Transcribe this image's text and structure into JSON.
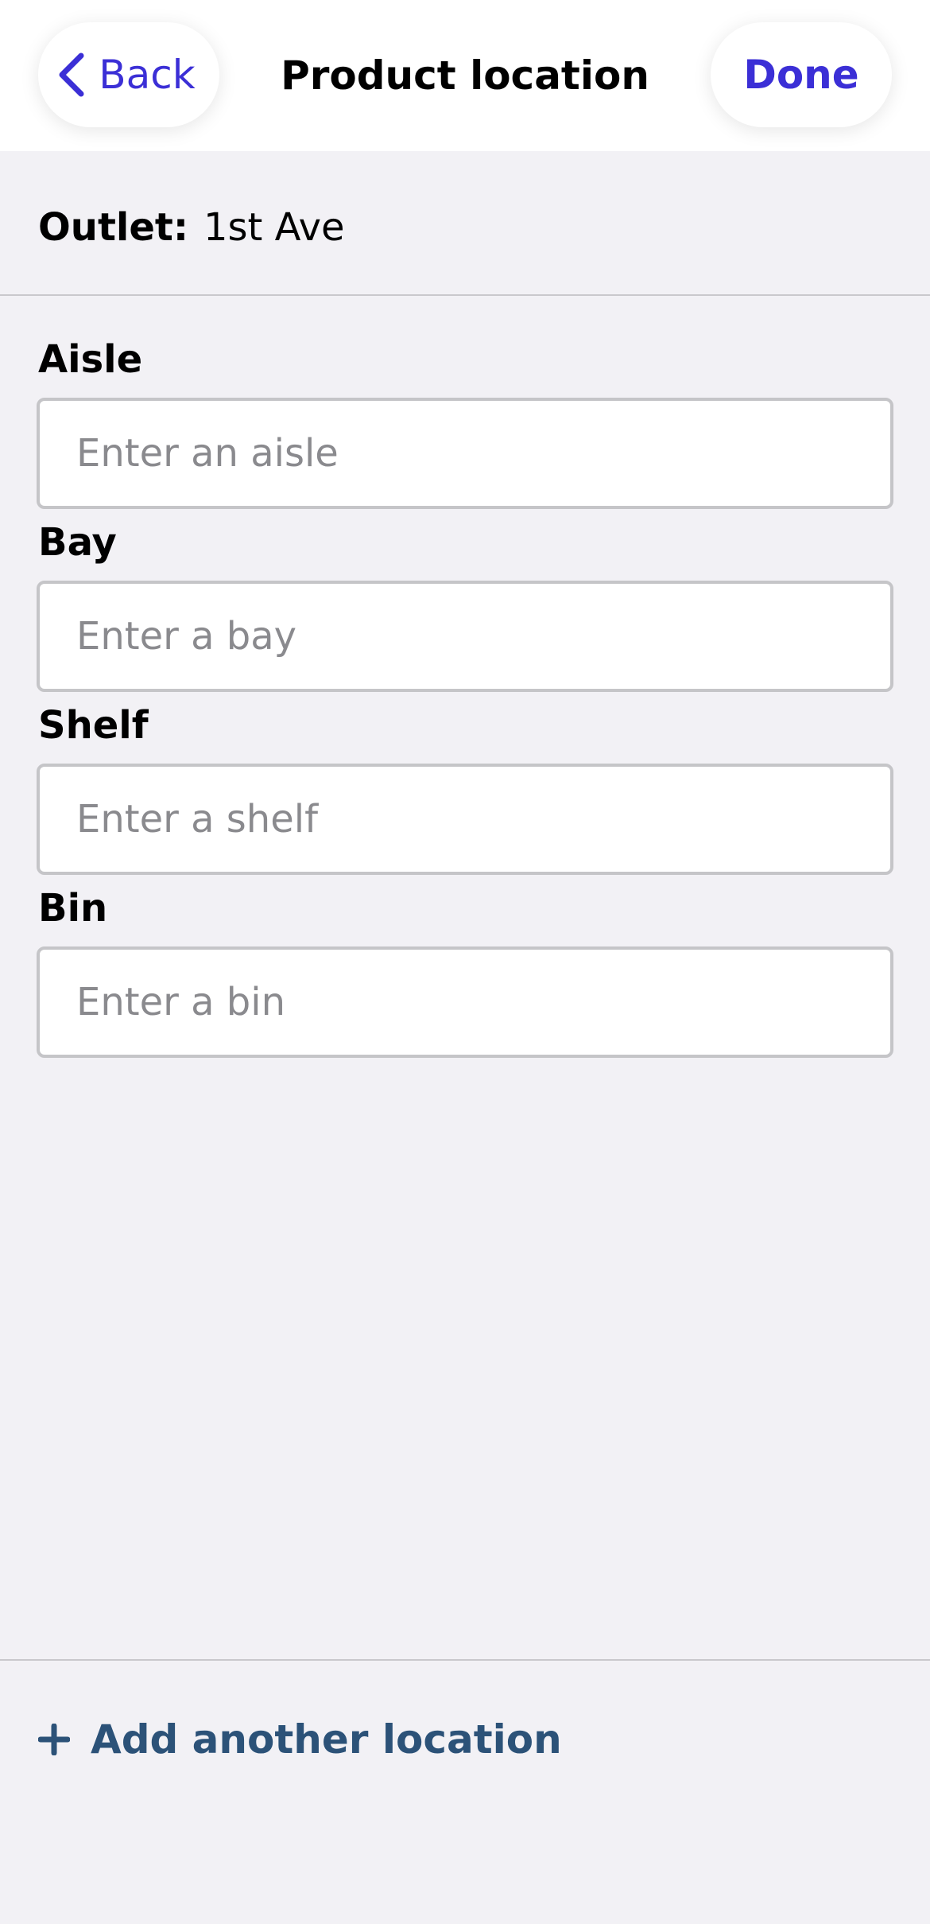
{
  "header": {
    "back_label": "Back",
    "title": "Product location",
    "done_label": "Done"
  },
  "outlet": {
    "label": "Outlet:",
    "value": "1st Ave"
  },
  "fields": [
    {
      "label": "Aisle",
      "value": "",
      "placeholder": "Enter an aisle"
    },
    {
      "label": "Bay",
      "value": "",
      "placeholder": "Enter a bay"
    },
    {
      "label": "Shelf",
      "value": "",
      "placeholder": "Enter a shelf"
    },
    {
      "label": "Bin",
      "value": "",
      "placeholder": "Enter a bin"
    }
  ],
  "footer": {
    "add_location_label": "Add another location"
  },
  "icons": {
    "back": "chevron-left-icon",
    "add": "plus-icon"
  },
  "colors": {
    "accent": "#3b2fd6",
    "link": "#2c5278",
    "background": "#f2f1f5",
    "input_border": "#c5c5c8",
    "placeholder": "#8a8a8e"
  }
}
